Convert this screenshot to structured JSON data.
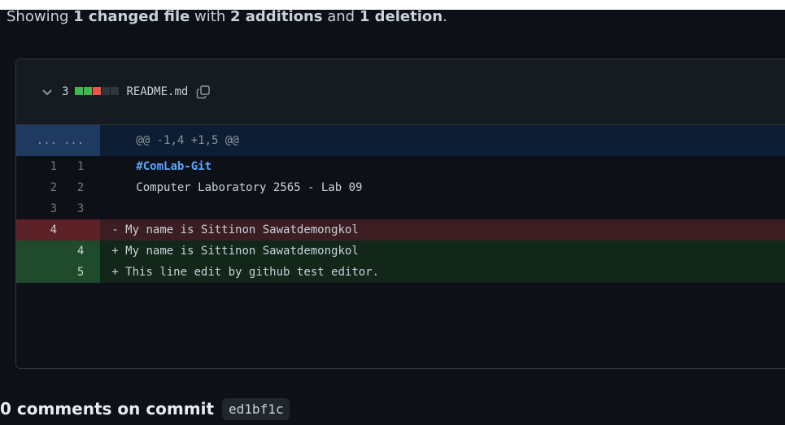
{
  "summary": {
    "prefix": "Showing ",
    "changed": "1 changed file",
    "with": " with ",
    "additions": "2 additions",
    "and": " and ",
    "deletions": "1 deletion",
    "suffix": "."
  },
  "file": {
    "count": "3",
    "name": "README.md",
    "diffstat": [
      "green",
      "green",
      "red",
      "neutral",
      "neutral"
    ]
  },
  "diff": {
    "hunk": {
      "old": "...",
      "new": "...",
      "text": "@@ -1,4 +1,5 @@"
    },
    "lines": [
      {
        "type": "ctx",
        "old": "1",
        "new": "1",
        "sign": " ",
        "text": "#ComLab-Git"
      },
      {
        "type": "ctx",
        "old": "2",
        "new": "2",
        "sign": " ",
        "text": "Computer Laboratory 2565 - Lab 09"
      },
      {
        "type": "ctx",
        "old": "3",
        "new": "3",
        "sign": " ",
        "text": ""
      },
      {
        "type": "del",
        "old": "4",
        "new": "",
        "sign": "-",
        "text": "My name is Sittinon Sawatdemongkol"
      },
      {
        "type": "add",
        "old": "",
        "new": "4",
        "sign": "+",
        "text": "My name is Sittinon Sawatdemongkol"
      },
      {
        "type": "add",
        "old": "",
        "new": "5",
        "sign": "+",
        "text": "This line edit by github test editor."
      }
    ]
  },
  "comments": {
    "label": "0 comments on commit",
    "sha": "ed1bf1c"
  }
}
